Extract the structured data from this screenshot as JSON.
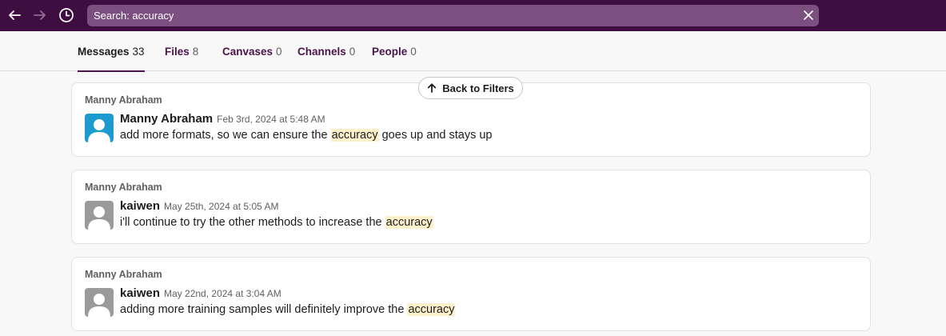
{
  "topbar": {
    "back_icon": "arrow-left-icon",
    "forward_icon": "arrow-right-icon",
    "history_icon": "clock-icon",
    "search": {
      "label": "Search: accuracy"
    },
    "clear_icon": "close-icon"
  },
  "tabs": [
    {
      "label": "Messages",
      "count": "33",
      "active": true
    },
    {
      "label": "Files",
      "count": "8",
      "active": false
    },
    {
      "label": "Canvases",
      "count": "0",
      "active": false
    },
    {
      "label": "Channels",
      "count": "0",
      "active": false
    },
    {
      "label": "People",
      "count": "0",
      "active": false
    }
  ],
  "back_to_filters": {
    "label": "Back to Filters",
    "icon": "arrow-up-icon"
  },
  "results": [
    {
      "channel": "Manny Abraham",
      "author": "Manny Abraham",
      "timestamp": "Feb 3rd, 2024 at 5:48 AM",
      "text_before": "add more formats, so we can ensure the ",
      "highlight": "accuracy",
      "text_after": " goes up and stays up",
      "avatar_color": "#1d9bd1"
    },
    {
      "channel": "Manny Abraham",
      "author": "kaiwen",
      "timestamp": "May 25th, 2024 at 5:05 AM",
      "text_before": "i'll continue to try the other methods to increase the ",
      "highlight": "accuracy",
      "text_after": "",
      "avatar_color": "#9a9a9a"
    },
    {
      "channel": "Manny Abraham",
      "author": "kaiwen",
      "timestamp": "May 22nd, 2024 at 3:04 AM",
      "text_before": "adding more training samples will definitely improve the ",
      "highlight": "accuracy",
      "text_after": "",
      "avatar_color": "#9a9a9a"
    }
  ],
  "colors": {
    "topbar": "#3f0e40",
    "search_box": "#7b4f80",
    "highlight": "#fdf1cc",
    "tab_accent": "#4a154b"
  }
}
